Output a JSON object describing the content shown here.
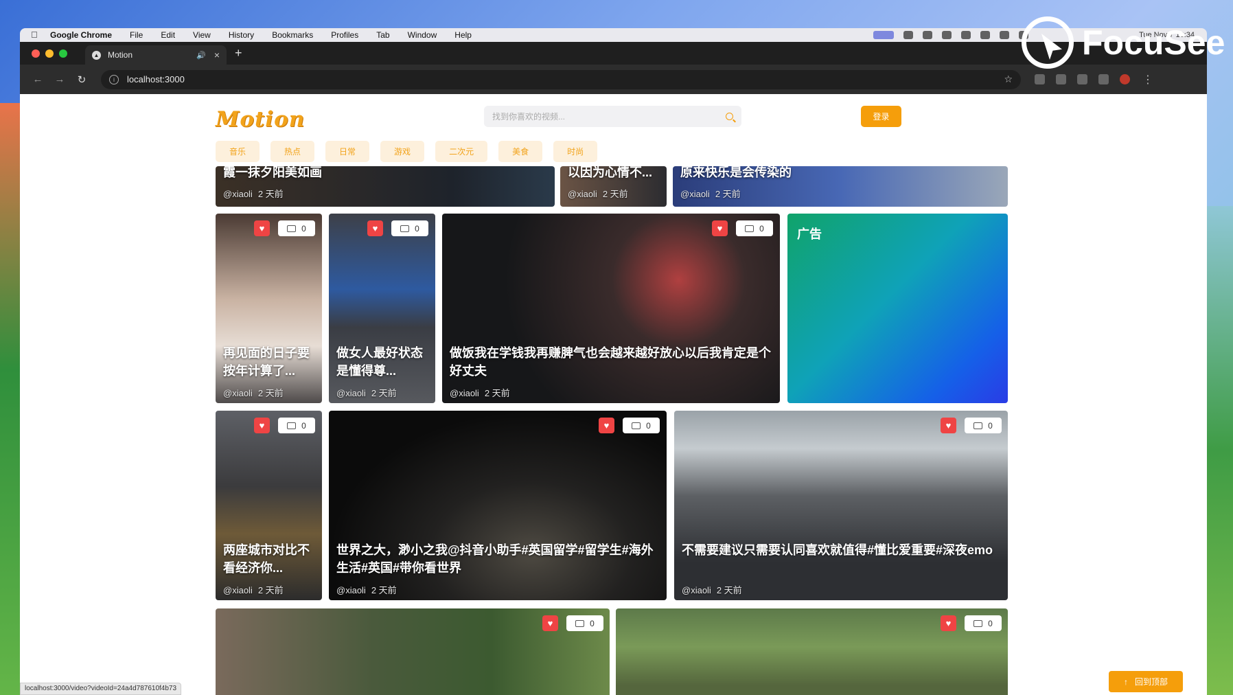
{
  "menubar": {
    "app": "Google Chrome",
    "items": [
      "File",
      "Edit",
      "View",
      "History",
      "Bookmarks",
      "Profiles",
      "Tab",
      "Window",
      "Help"
    ],
    "clock": "Tue Nov 7  19:34"
  },
  "browser": {
    "tab_title": "Motion",
    "url": "localhost:3000",
    "status_url": "localhost:3000/video?videoId=24a4d787610f4b73"
  },
  "site": {
    "logo": "Motion",
    "search_placeholder": "找到你喜欢的视频...",
    "login_label": "登录",
    "categories": [
      "音乐",
      "热点",
      "日常",
      "游戏",
      "二次元",
      "美食",
      "时尚"
    ],
    "back_to_top": "回到顶部",
    "ad_label": "广告"
  },
  "videos": {
    "top": [
      {
        "title": "霞一抹夕阳美如画",
        "author": "@xiaoli",
        "time": "2 天前"
      },
      {
        "title": "以因为心情不...",
        "author": "@xiaoli",
        "time": "2 天前"
      },
      {
        "title": "原来快乐是会传染的",
        "author": "@xiaoli",
        "time": "2 天前"
      }
    ],
    "row1": [
      {
        "title": "再见面的日子要按年计算了...",
        "author": "@xiaoli",
        "time": "2 天前",
        "comments": "0"
      },
      {
        "title": "做女人最好状态是懂得尊...",
        "author": "@xiaoli",
        "time": "2 天前",
        "comments": "0"
      },
      {
        "title": "做饭我在学钱我再赚脾气也会越来越好放心以后我肯定是个好丈夫",
        "author": "@xiaoli",
        "time": "2 天前",
        "comments": "0"
      }
    ],
    "row2": [
      {
        "title": "两座城市对比不看经济你...",
        "author": "@xiaoli",
        "time": "2 天前",
        "comments": "0"
      },
      {
        "title": "世界之大，渺小之我@抖音小助手#英国留学#留学生#海外生活#英国#带你看世界",
        "author": "@xiaoli",
        "time": "2 天前",
        "comments": "0"
      },
      {
        "title": "不需要建议只需要认同喜欢就值得#懂比爱重要#深夜emo",
        "author": "@xiaoli",
        "time": "2 天前",
        "comments": "0"
      }
    ],
    "row3": [
      {
        "comments": "0"
      },
      {
        "comments": "0"
      }
    ]
  },
  "watermark": "FocuSee",
  "colors": {
    "accent": "#f59e0b",
    "like": "#ef4444"
  }
}
